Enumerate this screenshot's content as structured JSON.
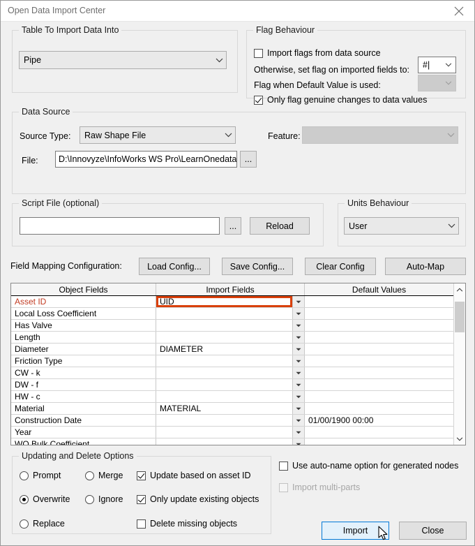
{
  "window": {
    "title": "Open Data Import Center",
    "close_icon": "close-icon"
  },
  "table_to_import": {
    "group_title": "Table To Import Data Into",
    "selected": "Pipe"
  },
  "flag_behaviour": {
    "group_title": "Flag Behaviour",
    "import_flags_label": "Import flags from data source",
    "import_flags_checked": false,
    "otherwise_label": "Otherwise, set flag on imported fields to:",
    "otherwise_value": "#|",
    "default_value_label": "Flag when Default Value is used:",
    "default_value_value": "",
    "only_flag_label": "Only flag genuine changes to data values",
    "only_flag_checked": true
  },
  "data_source": {
    "group_title": "Data Source",
    "source_type_label": "Source Type:",
    "source_type_value": "Raw Shape File",
    "feature_label": "Feature:",
    "feature_value": "",
    "file_label": "File:",
    "file_value": "D:\\Innovyze\\InfoWorks WS Pro\\LearnOnedata\\",
    "browse_label": "..."
  },
  "script_file": {
    "group_title": "Script File (optional)",
    "value": "",
    "browse_label": "...",
    "reload_label": "Reload"
  },
  "units_behaviour": {
    "group_title": "Units Behaviour",
    "selected": "User"
  },
  "field_mapping": {
    "label": "Field Mapping Configuration:",
    "load_label": "Load Config...",
    "save_label": "Save Config...",
    "clear_label": "Clear Config",
    "automap_label": "Auto-Map"
  },
  "mapping_table": {
    "columns": [
      "Object Fields",
      "Import Fields",
      "Default Values"
    ],
    "rows": [
      {
        "object_field": "Asset ID",
        "import_field": "UID",
        "default_value": "",
        "key": true,
        "active": true
      },
      {
        "object_field": "Local Loss Coefficient",
        "import_field": "",
        "default_value": "",
        "key": false,
        "active": false
      },
      {
        "object_field": "Has Valve",
        "import_field": "",
        "default_value": "",
        "key": false,
        "active": false
      },
      {
        "object_field": "Length",
        "import_field": "",
        "default_value": "",
        "key": false,
        "active": false
      },
      {
        "object_field": "Diameter",
        "import_field": "DIAMETER",
        "default_value": "",
        "key": false,
        "active": false
      },
      {
        "object_field": "Friction Type",
        "import_field": "",
        "default_value": "",
        "key": false,
        "active": false
      },
      {
        "object_field": "CW - k",
        "import_field": "",
        "default_value": "",
        "key": false,
        "active": false
      },
      {
        "object_field": "DW - f",
        "import_field": "",
        "default_value": "",
        "key": false,
        "active": false
      },
      {
        "object_field": "HW - c",
        "import_field": "",
        "default_value": "",
        "key": false,
        "active": false
      },
      {
        "object_field": "Material",
        "import_field": "MATERIAL",
        "default_value": "",
        "key": false,
        "active": false
      },
      {
        "object_field": "Construction Date",
        "import_field": "",
        "default_value": "01/00/1900 00:00",
        "key": false,
        "active": false
      },
      {
        "object_field": "Year",
        "import_field": "",
        "default_value": "",
        "key": false,
        "active": false
      },
      {
        "object_field": "WQ Bulk Coefficient",
        "import_field": "",
        "default_value": "",
        "key": false,
        "active": false
      }
    ]
  },
  "updating_options": {
    "group_title": "Updating and Delete Options",
    "radios_left": [
      {
        "label": "Prompt",
        "checked": false
      },
      {
        "label": "Overwrite",
        "checked": true
      },
      {
        "label": "Replace",
        "checked": false
      }
    ],
    "radios_mid": [
      {
        "label": "Merge",
        "checked": false
      },
      {
        "label": "Ignore",
        "checked": false
      }
    ],
    "checkboxes": [
      {
        "label": "Update based on asset ID",
        "checked": true
      },
      {
        "label": "Only update existing objects",
        "checked": true
      },
      {
        "label": "Delete missing objects",
        "checked": false
      }
    ]
  },
  "right_options": {
    "auto_name_label": "Use auto-name option for generated nodes",
    "auto_name_checked": false,
    "multi_parts_label": "Import multi-parts",
    "multi_parts_checked": false,
    "multi_parts_disabled": true
  },
  "actions": {
    "import_label": "Import",
    "close_label": "Close"
  },
  "colors": {
    "accent_highlight": "#d9400b",
    "key_field": "#c23b22",
    "focus_blue": "#0078d7",
    "dialog_bg": "#f0f0f0"
  }
}
